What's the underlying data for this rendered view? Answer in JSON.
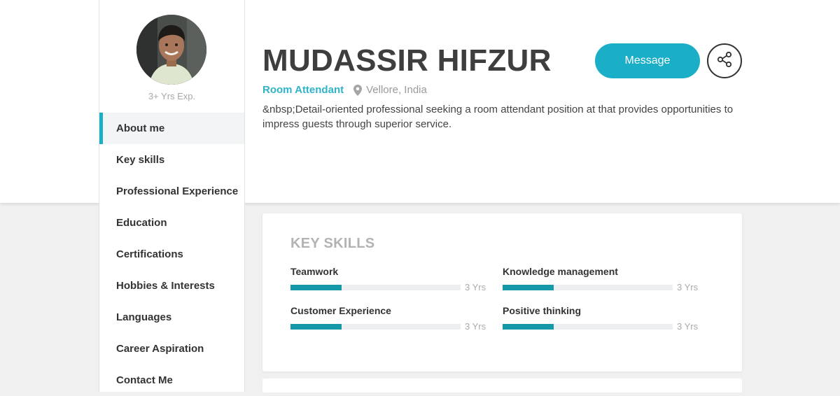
{
  "profile": {
    "experience": "3+ Yrs Exp.",
    "name": "MUDASSIR HIFZUR",
    "role": "Room Attendant",
    "location": "Vellore, India",
    "summary": "&nbsp;Detail-oriented professional seeking a room attendant position at that provides opportunities to impress guests through superior service."
  },
  "actions": {
    "message_label": "Message",
    "share_icon": "share-icon"
  },
  "nav": {
    "items": [
      {
        "label": "About me",
        "active": true
      },
      {
        "label": "Key skills"
      },
      {
        "label": "Professional Experience"
      },
      {
        "label": "Education"
      },
      {
        "label": "Certifications"
      },
      {
        "label": "Hobbies & Interests"
      },
      {
        "label": "Languages"
      },
      {
        "label": "Career Aspiration"
      },
      {
        "label": "Contact Me"
      }
    ]
  },
  "key_skills": {
    "title": "KEY SKILLS",
    "skills": [
      {
        "name": "Teamwork",
        "years": "3 Yrs",
        "level": 0.3
      },
      {
        "name": "Knowledge management",
        "years": "3 Yrs",
        "level": 0.3
      },
      {
        "name": "Customer Experience",
        "years": "3 Yrs",
        "level": 0.3
      },
      {
        "name": "Positive thinking",
        "years": "3 Yrs",
        "level": 0.3
      }
    ]
  },
  "colors": {
    "accent": "#1aafc7",
    "bar_fill": "#1599a8",
    "role_text": "#2fb3c9"
  },
  "icons": {
    "location": "map-pin-icon",
    "share": "share-icon",
    "avatar": "profile-photo"
  }
}
